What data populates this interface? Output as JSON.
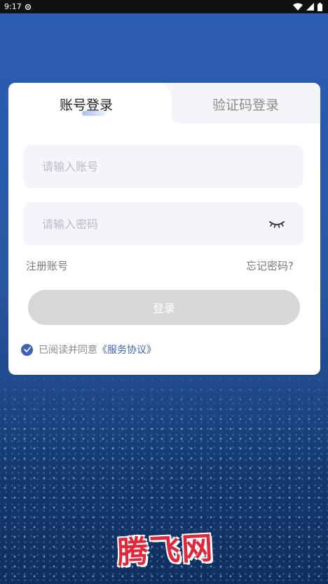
{
  "status_bar": {
    "time": "9:17",
    "icons": [
      "settings-icon",
      "wifi-icon",
      "signal-icon",
      "battery-icon"
    ]
  },
  "tabs": [
    {
      "label": "账号登录",
      "active": true
    },
    {
      "label": "验证码登录",
      "active": false
    }
  ],
  "form": {
    "account_placeholder": "请输入账号",
    "password_placeholder": "请输入密码",
    "register_link": "注册账号",
    "forgot_link": "忘记密码?",
    "login_button": "登录",
    "agreement_prefix": "已阅读并同意",
    "agreement_link": "《服务协议》",
    "agreement_checked": true
  },
  "brand": {
    "logo_text": "腾飞网"
  },
  "colors": {
    "accent": "#3e63b6",
    "background": "#2a5aac",
    "button_disabled": "#d7d7d7",
    "brand_red": "#e0283c"
  }
}
